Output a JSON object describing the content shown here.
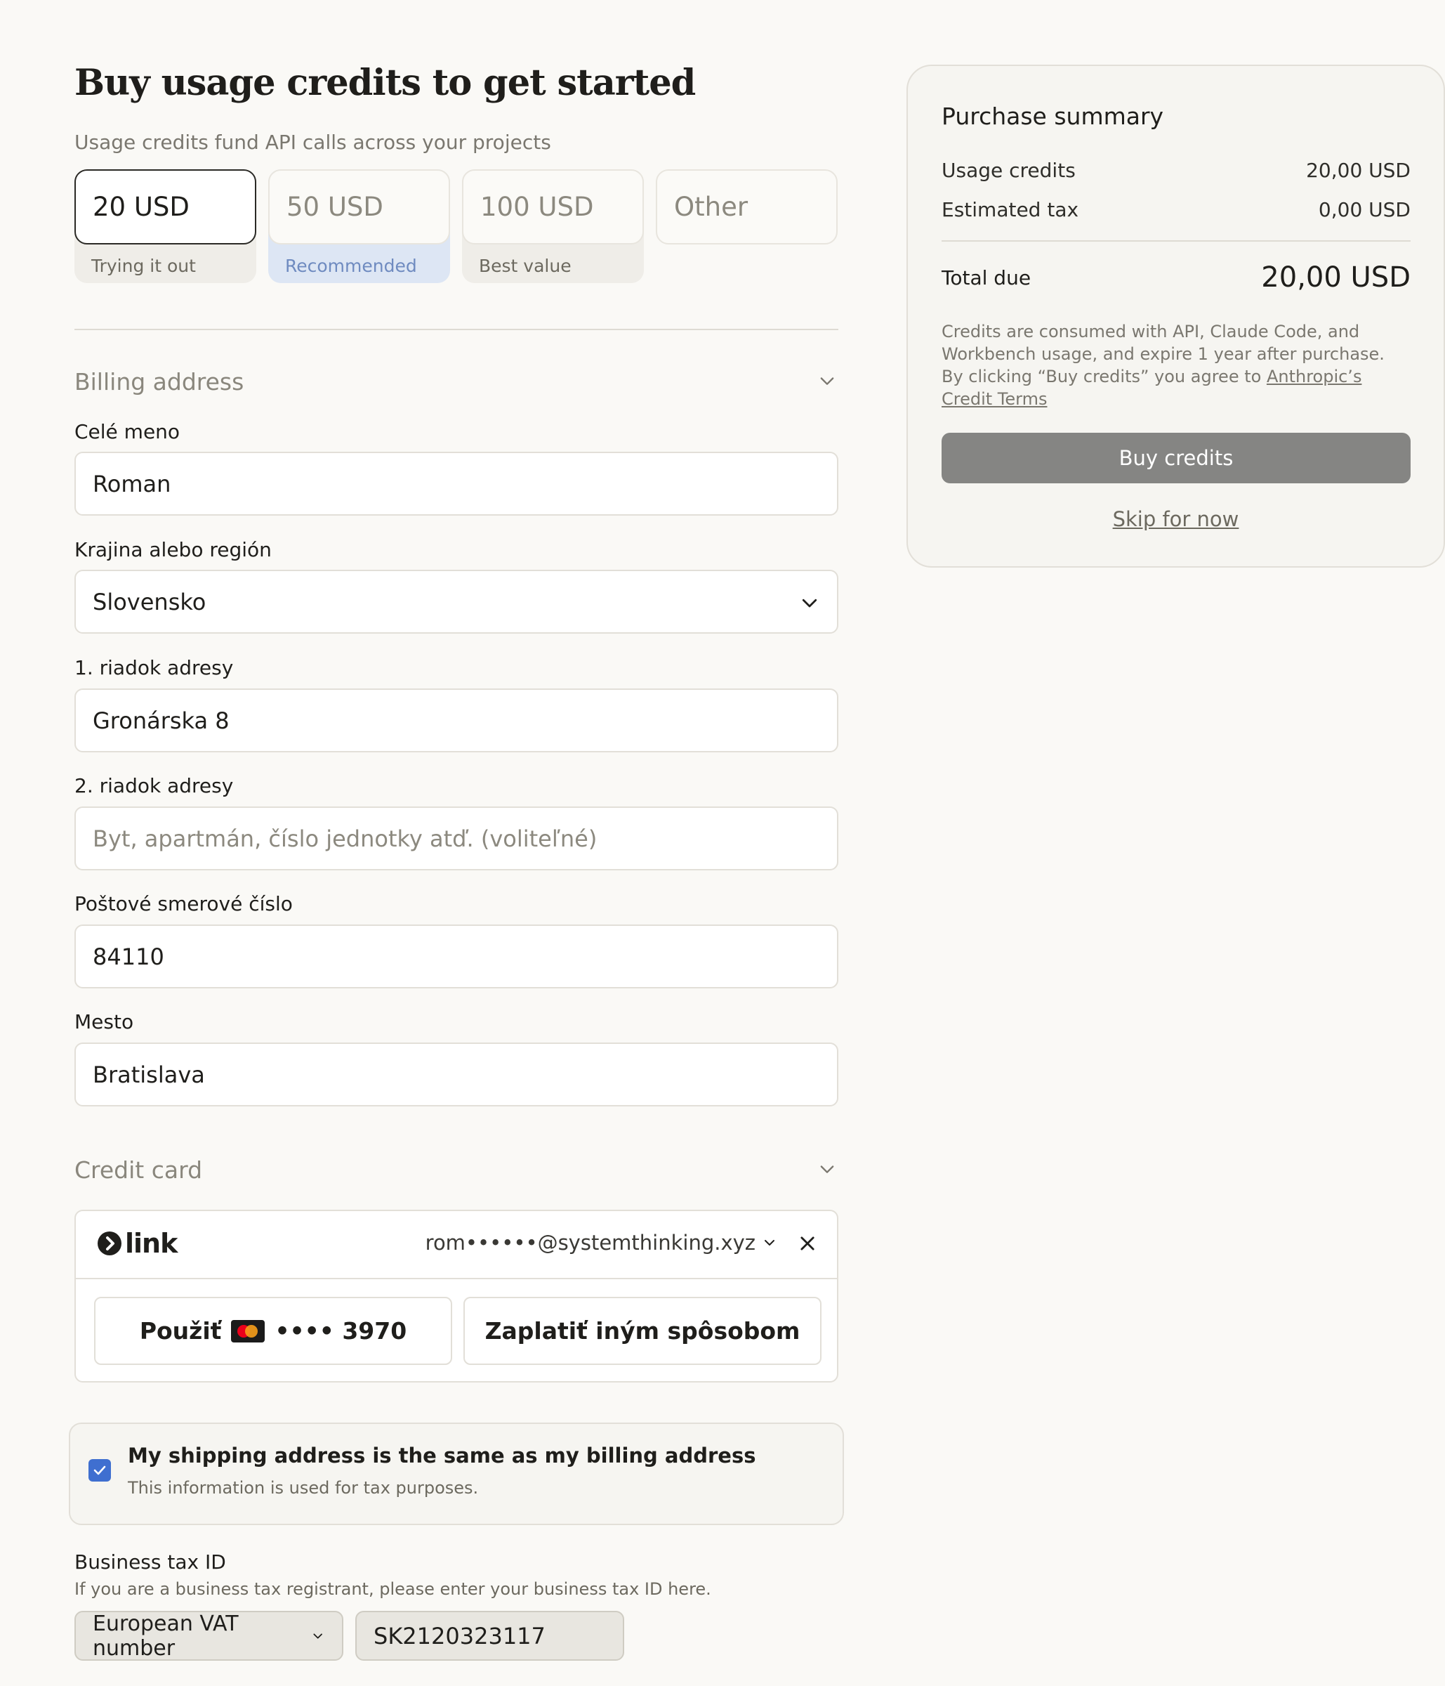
{
  "page": {
    "title": "Buy usage credits to get started",
    "subtitle": "Usage credits fund API calls across your projects"
  },
  "amounts": [
    {
      "label": "20 USD",
      "tag": "Trying it out",
      "selected": true
    },
    {
      "label": "50 USD",
      "tag": "Recommended"
    },
    {
      "label": "100 USD",
      "tag": "Best value"
    },
    {
      "label": "Other",
      "tag": ""
    }
  ],
  "billing": {
    "section_title": "Billing address",
    "full_name_label": "Celé meno",
    "full_name_value": "Roman",
    "country_label": "Krajina alebo región",
    "country_value": "Slovensko",
    "address1_label": "1. riadok adresy",
    "address1_value": "Gronárska 8",
    "address2_label": "2. riadok adresy",
    "address2_placeholder": "Byt, apartmán, číslo jednotky atď. (voliteľné)",
    "postal_label": "Poštové smerové číslo",
    "postal_value": "84110",
    "city_label": "Mesto",
    "city_value": "Bratislava"
  },
  "credit_card": {
    "section_title": "Credit card",
    "link_logo": "link",
    "email": "rom••••••@systemthinking.xyz",
    "use_label": "Použiť",
    "card_digits": "•••• 3970",
    "pay_other_label": "Zaplatiť iným spôsobom"
  },
  "shipping": {
    "title": "My shipping address is the same as my billing address",
    "subtitle": "This information is used for tax purposes.",
    "checked": true
  },
  "tax": {
    "label": "Business tax ID",
    "help": "If you are a business tax registrant, please enter your business tax ID here.",
    "type_value": "European VAT number",
    "id_value": "SK2120323117"
  },
  "summary": {
    "title": "Purchase summary",
    "usage_label": "Usage credits",
    "usage_value": "20,00 USD",
    "tax_label": "Estimated tax",
    "tax_value": "0,00 USD",
    "total_label": "Total due",
    "total_value": "20,00 USD",
    "note_text": "Credits are consumed with API, Claude Code, and Workbench usage, and expire 1 year after purchase. By clicking “Buy credits” you agree to ",
    "note_link": "Anthropic’s Credit Terms",
    "buy_label": "Buy credits",
    "skip_label": "Skip for now"
  },
  "colors": {
    "accent_blue": "#3f6fd0",
    "buy_button": "#858583",
    "recommended_bg": "#dde6f4"
  }
}
